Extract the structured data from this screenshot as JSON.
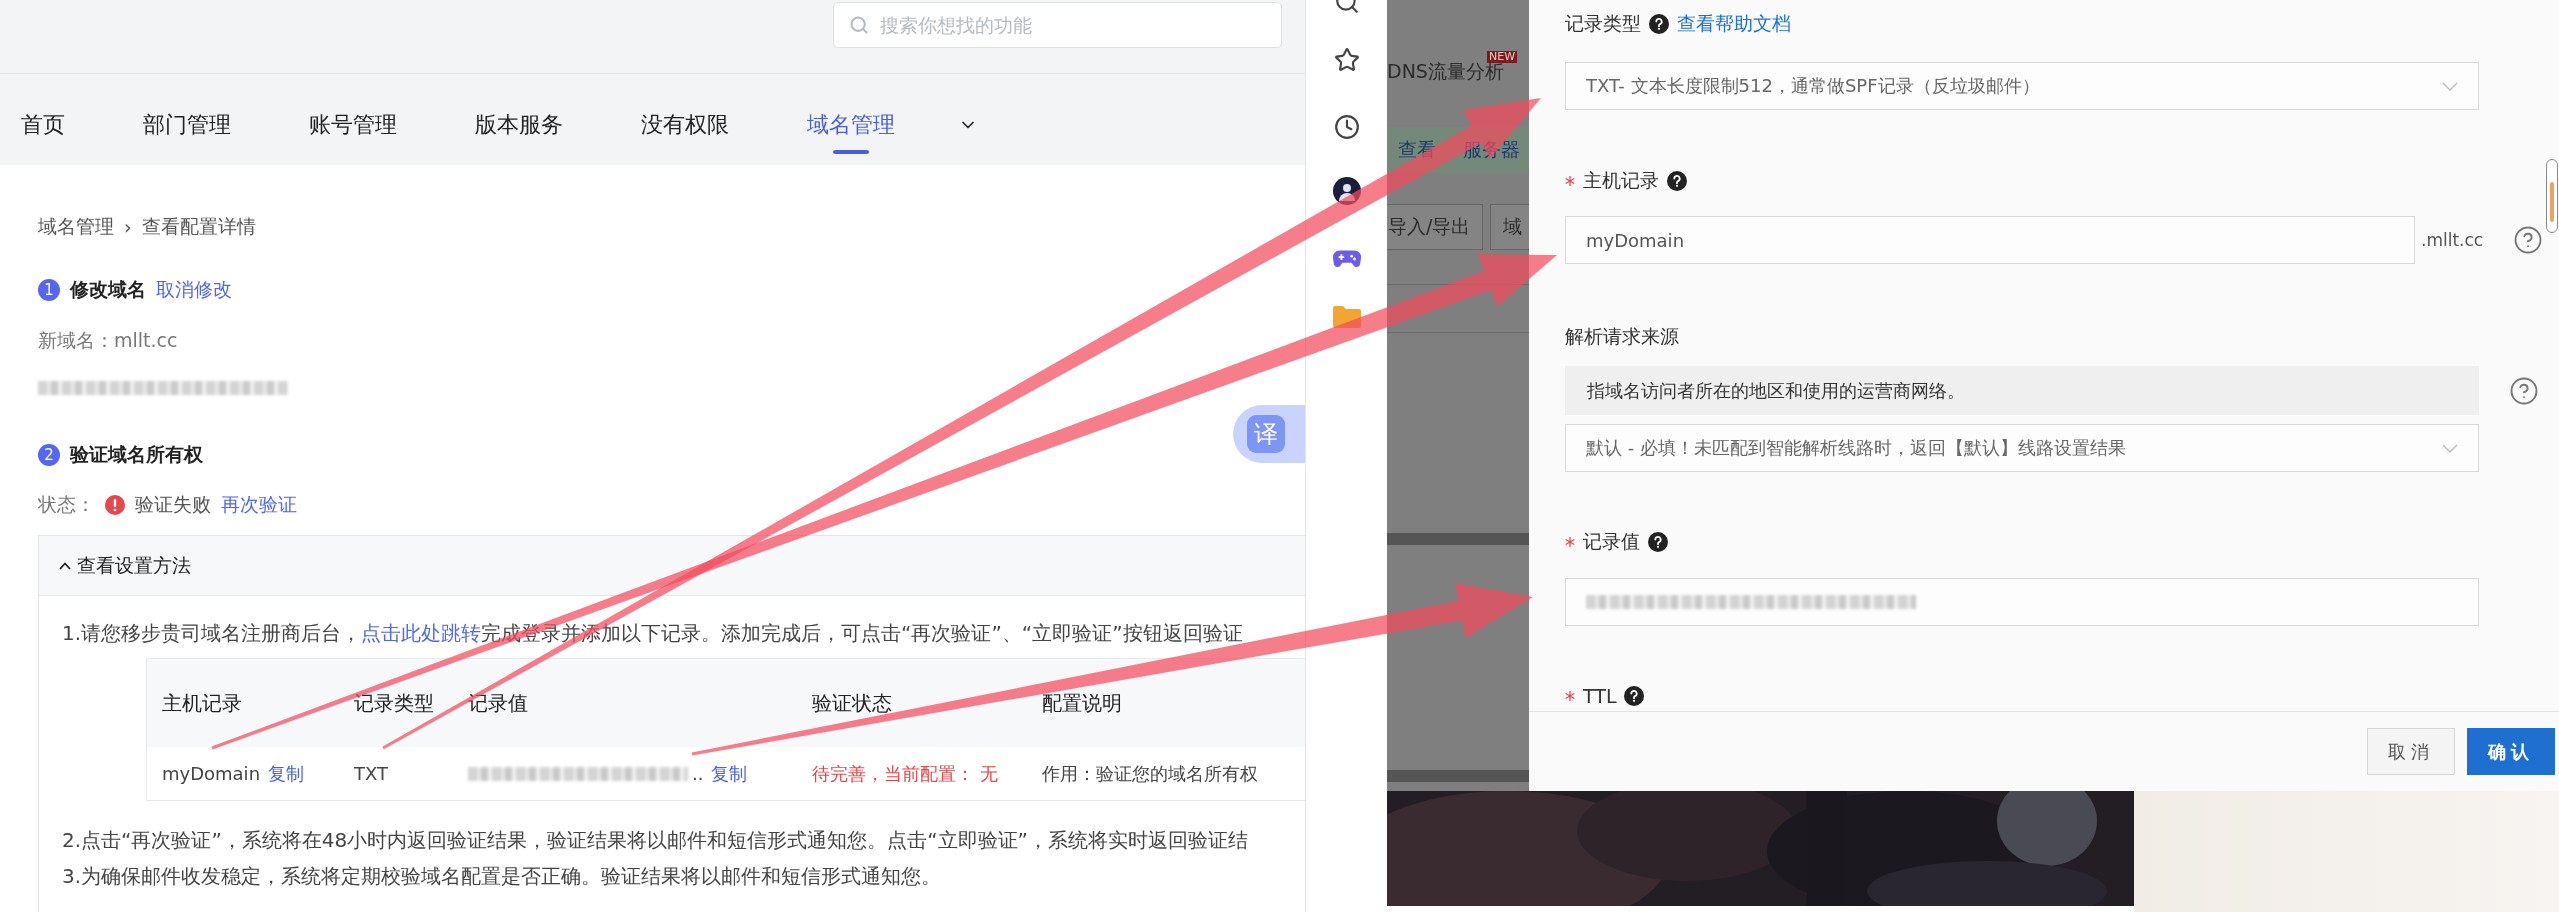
{
  "header": {
    "search": {
      "placeholder": "搜索你想找的功能"
    }
  },
  "nav": {
    "tabs": [
      {
        "label": "首页",
        "selected": false
      },
      {
        "label": "部门管理",
        "selected": false
      },
      {
        "label": "账号管理",
        "selected": false
      },
      {
        "label": "版本服务",
        "selected": false
      },
      {
        "label": "没有权限",
        "selected": false
      },
      {
        "label": "域名管理",
        "selected": true
      }
    ]
  },
  "breadcrumb": {
    "parent": "域名管理",
    "separator": "›",
    "current": "查看配置详情"
  },
  "step1": {
    "number": "1",
    "title": "修改域名",
    "link": "取消修改",
    "new_domain": "新域名：mllt.cc",
    "redacted": true
  },
  "step2": {
    "number": "2",
    "title": "验证域名所有权",
    "status_label": "状态：",
    "status_error": true,
    "status": "验证失败",
    "link": "再次验证"
  },
  "panel": {
    "title": "查看设置方法",
    "expanded": true,
    "intro": [
      {
        "text": "1.请您移步贵司域名注册商后台，",
        "link": false
      },
      {
        "text": "点击此处跳转",
        "link": true
      },
      {
        "text": "完成登录并添加以下记录。添加完成后，可点击“再次验证”、“立即验证”按钮返回验证",
        "link": false
      }
    ],
    "table": {
      "columns": [
        "主机记录",
        "记录类型",
        "记录值",
        "验证状态",
        "配置说明"
      ],
      "rows": [
        {
          "host": "myDomain",
          "host_action": "复制",
          "type": "TXT",
          "value_redacted": true,
          "value_suffix": "..",
          "value_action": "复制",
          "status": "待完善，当前配置： 无",
          "status_error": true,
          "note": "作用：验证您的域名所有权"
        }
      ]
    },
    "notes": [
      "2.点击“再次验证”，系统将在48小时内返回验证结果，验证结果将以邮件和短信形式通知您。点击“立即验证”，系统将实时返回验证结",
      "3.为确保邮件收发稳定，系统将定期校验域名配置是否正确。验证结果将以邮件和短信形式通知您。"
    ]
  },
  "translate_button": {
    "label": "译"
  },
  "background_app": {
    "nav_item": {
      "label": "DNS流量分析",
      "badge": "NEW"
    },
    "notice": [
      "查看",
      "服务器"
    ],
    "buttons": [
      "导入/导出",
      "域"
    ]
  },
  "drawer": {
    "fields": [
      {
        "kind": "select",
        "label": "记录类型",
        "required": false,
        "help": true,
        "link": "查看帮助文档",
        "value": "TXT- 文本长度限制512，通常做SPF记录（反垃圾邮件）"
      },
      {
        "kind": "input",
        "label": "主机记录",
        "required": true,
        "help": true,
        "value": "myDomain",
        "suffix": ".mllt.cc",
        "side_help": true
      },
      {
        "kind": "select",
        "label": "解析请求来源",
        "required": false,
        "help": false,
        "hint": "指域名访问者所在的地区和使用的运营商网络。",
        "side_help": true,
        "value": "默认 - 必填！未匹配到智能解析线路时，返回【默认】线路设置结果"
      },
      {
        "kind": "input",
        "label": "记录值",
        "required": true,
        "help": true,
        "redacted": true
      },
      {
        "kind": "label",
        "label": "TTL",
        "required": true,
        "help": true
      }
    ],
    "buttons": [
      {
        "label": "取消",
        "primary": false
      },
      {
        "label": "确认",
        "primary": true
      }
    ]
  }
}
